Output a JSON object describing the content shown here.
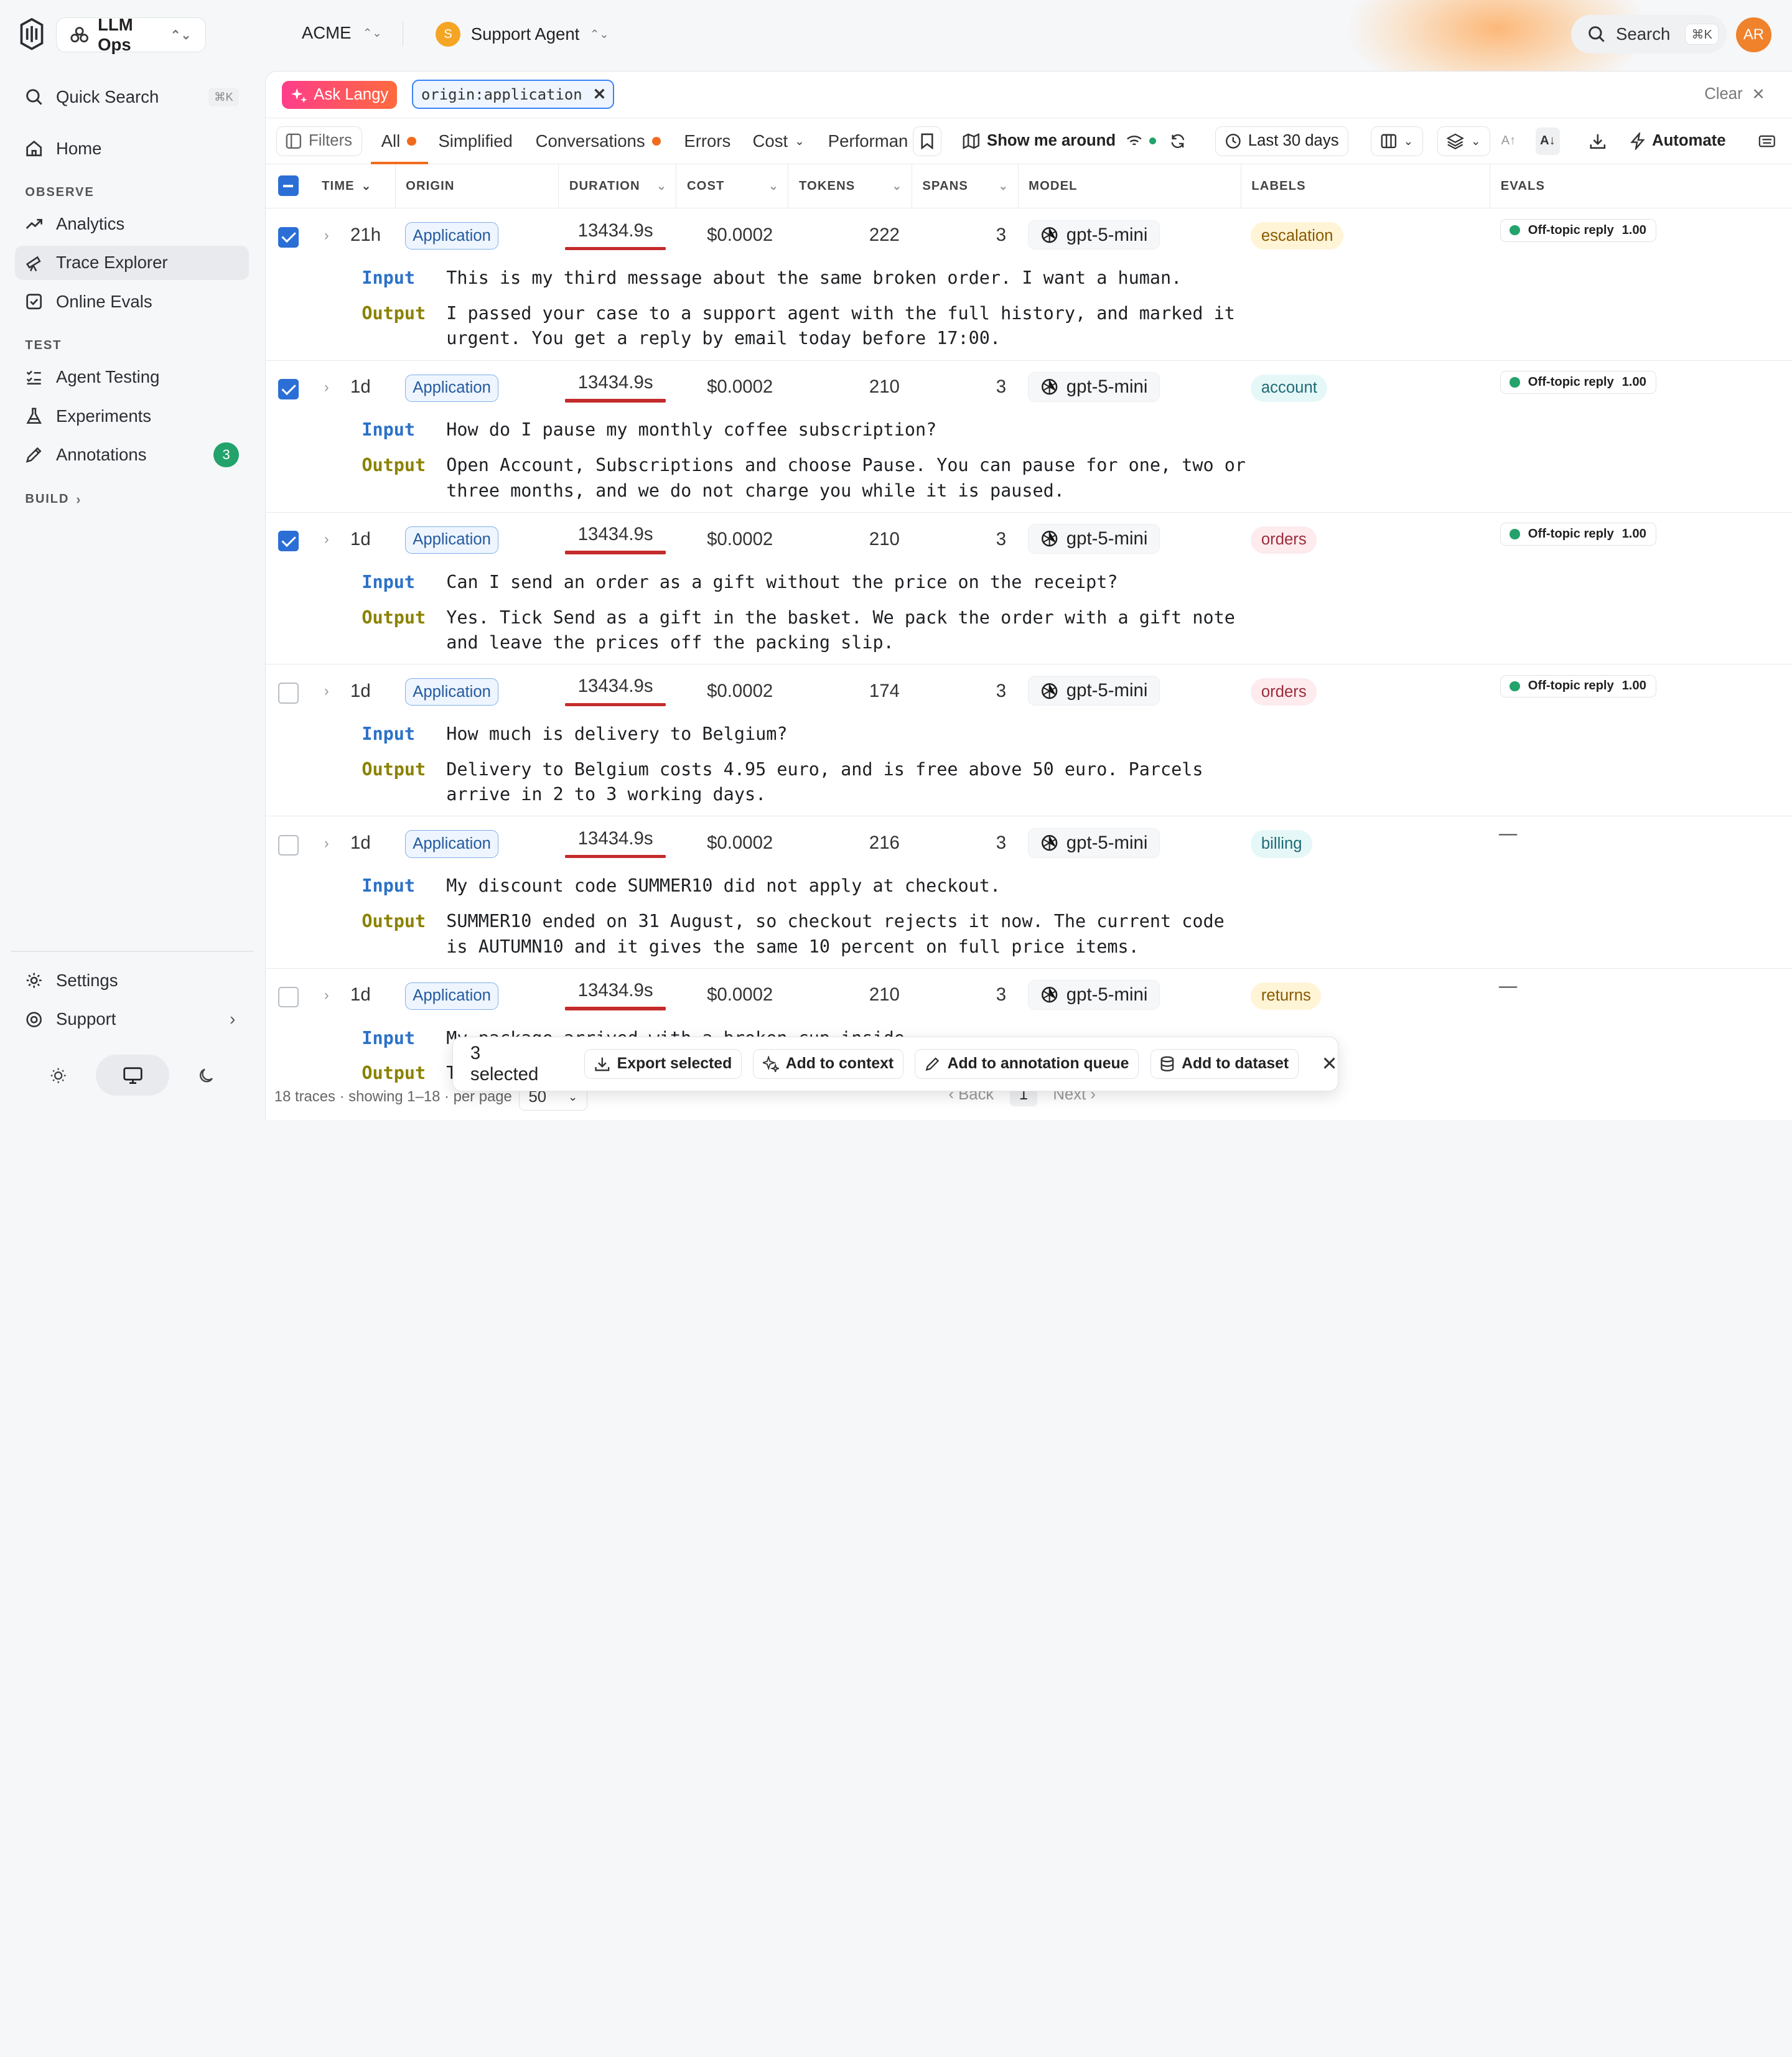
{
  "project": {
    "name": "LLM Ops"
  },
  "org": {
    "name": "ACME"
  },
  "agent": {
    "initial": "S",
    "name": "Support Agent"
  },
  "search": {
    "label": "Search",
    "shortcut": "⌘K"
  },
  "user": {
    "initials": "AR"
  },
  "sidebar": {
    "quick_search": "Quick Search",
    "quick_search_kbd": "⌘K",
    "home": "Home",
    "observe_label": "OBSERVE",
    "analytics": "Analytics",
    "trace_explorer": "Trace Explorer",
    "online_evals": "Online Evals",
    "test_label": "TEST",
    "agent_testing": "Agent Testing",
    "experiments": "Experiments",
    "annotations": "Annotations",
    "annotations_count": "3",
    "build_label": "BUILD",
    "settings": "Settings",
    "support": "Support"
  },
  "query": {
    "ask_label": "Ask Langy",
    "chip": "origin:application",
    "clear": "Clear"
  },
  "toolbar": {
    "filters": "Filters",
    "tabs": [
      "All",
      "Simplified",
      "Conversations",
      "Errors",
      "Cost",
      "Performan"
    ],
    "show_me_around": "Show me around",
    "date_range": "Last 30 days",
    "automate": "Automate"
  },
  "columns": [
    "TIME",
    "ORIGIN",
    "DURATION",
    "COST",
    "TOKENS",
    "SPANS",
    "MODEL",
    "LABELS",
    "EVALS"
  ],
  "rows": [
    {
      "checked": true,
      "time": "21h",
      "origin": "Application",
      "duration": "13434.9s",
      "cost": "$0.0002",
      "tokens": "222",
      "spans": "3",
      "model": "gpt-5-mini",
      "label": "escalation",
      "eval": "Off-topic reply",
      "score": "1.00",
      "input": "This is my third message about the same broken order. I want a human.",
      "output": "I passed your case to a support agent with the full history, and marked it urgent. You get a reply by email today before 17:00."
    },
    {
      "checked": true,
      "time": "1d",
      "origin": "Application",
      "duration": "13434.9s",
      "cost": "$0.0002",
      "tokens": "210",
      "spans": "3",
      "model": "gpt-5-mini",
      "label": "account",
      "eval": "Off-topic reply",
      "score": "1.00",
      "input": "How do I pause my monthly coffee subscription?",
      "output": "Open Account, Subscriptions and choose Pause. You can pause for one, two or three months, and we do not charge you while it is paused."
    },
    {
      "checked": true,
      "time": "1d",
      "origin": "Application",
      "duration": "13434.9s",
      "cost": "$0.0002",
      "tokens": "210",
      "spans": "3",
      "model": "gpt-5-mini",
      "label": "orders",
      "eval": "Off-topic reply",
      "score": "1.00",
      "input": "Can I send an order as a gift without the price on the receipt?",
      "output": "Yes. Tick Send as a gift in the basket. We pack the order with a gift note and leave the prices off the packing slip."
    },
    {
      "checked": false,
      "time": "1d",
      "origin": "Application",
      "duration": "13434.9s",
      "cost": "$0.0002",
      "tokens": "174",
      "spans": "3",
      "model": "gpt-5-mini",
      "label": "orders",
      "eval": "Off-topic reply",
      "score": "1.00",
      "input": "How much is delivery to Belgium?",
      "output": "Delivery to Belgium costs 4.95 euro, and is free above 50 euro. Parcels arrive in 2 to 3 working days."
    },
    {
      "checked": false,
      "time": "1d",
      "origin": "Application",
      "duration": "13434.9s",
      "cost": "$0.0002",
      "tokens": "216",
      "spans": "3",
      "model": "gpt-5-mini",
      "label": "billing",
      "eval": "",
      "score": "",
      "input": "My discount code SUMMER10 did not apply at checkout.",
      "output": "SUMMER10 ended on 31 August, so checkout rejects it now. The current code is AUTUMN10 and it gives the same 10 percent on full price items."
    },
    {
      "checked": false,
      "time": "1d",
      "origin": "Application",
      "duration": "13434.9s",
      "cost": "$0.0002",
      "tokens": "210",
      "spans": "3",
      "model": "gpt-5-mini",
      "label": "returns",
      "eval": "",
      "score": "",
      "input": "My package arrived with a broken cup inside.",
      "output": "T"
    }
  ],
  "io_labels": {
    "input": "Input",
    "output": "Output"
  },
  "empty_eval": "—",
  "bulk": {
    "selected": "3 selected",
    "export": "Export selected",
    "context": "Add to context",
    "annotation": "Add to annotation queue",
    "dataset": "Add to dataset"
  },
  "footer": {
    "summary": "18 traces · showing 1–18 · per page",
    "per_page": "50",
    "back": "Back",
    "page": "1",
    "next": "Next"
  },
  "colors": {
    "accent": "#f26b1d",
    "link": "#2b6fd6",
    "duration_bar": "#c42b2b"
  }
}
